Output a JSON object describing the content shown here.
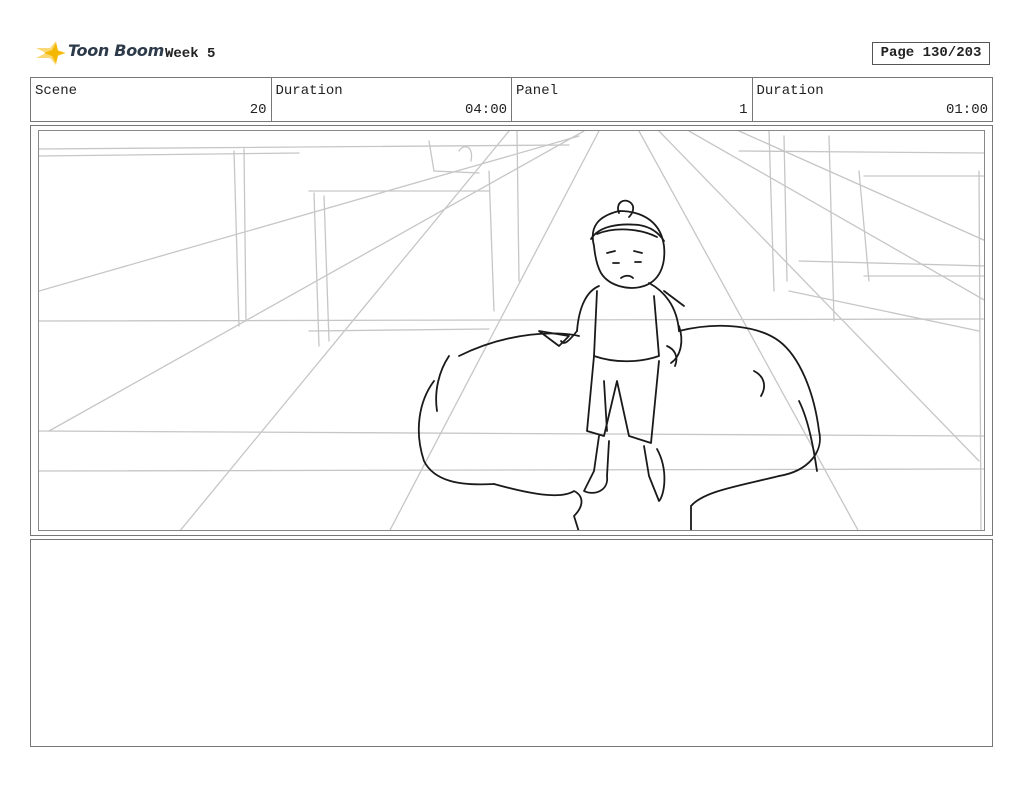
{
  "header": {
    "brand": "Toon Boom",
    "project_title": "Week 5",
    "page_label": "Page 130/203"
  },
  "info": {
    "scene_label": "Scene",
    "scene_value": "20",
    "scene_duration_label": "Duration",
    "scene_duration_value": "04:00",
    "panel_label": "Panel",
    "panel_value": "1",
    "panel_duration_label": "Duration",
    "panel_duration_value": "01:00"
  },
  "colors": {
    "logo_star": "#f5b800",
    "logo_text": "#2d3a4a",
    "border": "#777777"
  },
  "notes": {
    "text": ""
  }
}
